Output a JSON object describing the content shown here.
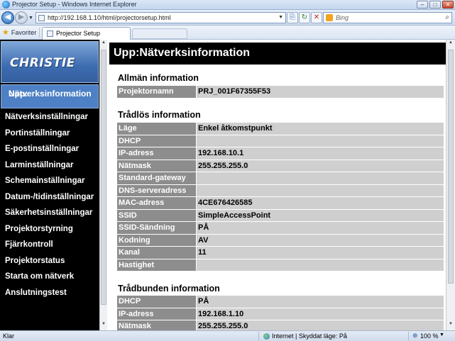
{
  "window": {
    "title": "Projector Setup - Windows Internet Explorer"
  },
  "address": {
    "url": "http://192.168.1.10/html/projectorsetup.html",
    "search_placeholder": "Bing"
  },
  "favorites": {
    "label": "Favoriter",
    "tab_label": "Projector Setup"
  },
  "sidebar": {
    "logo": "CHRISTIE",
    "active_line1": "Upp:",
    "active_line2": "Nätverksinformation",
    "items": [
      "Nätverksinställningar",
      "Portinställningar",
      "E-postinställningar",
      "Larminställningar",
      "Schemainställningar",
      "Datum-/tidinställningar",
      "Säkerhetsinställningar",
      "Projektorstyrning",
      "Fjärrkontroll",
      "Projektorstatus",
      "Starta om nätverk",
      "Anslutningstest"
    ]
  },
  "main": {
    "header": "Upp:Nätverksinformation",
    "general": {
      "title": "Allmän information",
      "rows": [
        {
          "k": "Projektornamn",
          "v": "PRJ_001F67355F53"
        }
      ]
    },
    "wireless": {
      "title": "Trådlös information",
      "rows": [
        {
          "k": "Läge",
          "v": "Enkel åtkomstpunkt"
        },
        {
          "k": "DHCP",
          "v": ""
        },
        {
          "k": "IP-adress",
          "v": "192.168.10.1"
        },
        {
          "k": "Nätmask",
          "v": "255.255.255.0"
        },
        {
          "k": "Standard-gateway",
          "v": ""
        },
        {
          "k": "DNS-serveradress",
          "v": ""
        },
        {
          "k": "MAC-adress",
          "v": "4CE676426585"
        },
        {
          "k": "SSID",
          "v": "SimpleAccessPoint"
        },
        {
          "k": "SSID-Sändning",
          "v": "PÅ"
        },
        {
          "k": "Kodning",
          "v": "AV"
        },
        {
          "k": "Kanal",
          "v": "11"
        },
        {
          "k": "Hastighet",
          "v": ""
        }
      ]
    },
    "wired": {
      "title": "Trådbunden information",
      "rows": [
        {
          "k": "DHCP",
          "v": "PÅ"
        },
        {
          "k": "IP-adress",
          "v": "192.168.1.10"
        },
        {
          "k": "Nätmask",
          "v": "255.255.255.0"
        }
      ]
    }
  },
  "status": {
    "ready": "Klar",
    "zone": "Internet | Skyddat läge: På",
    "zoom": "100 %"
  }
}
